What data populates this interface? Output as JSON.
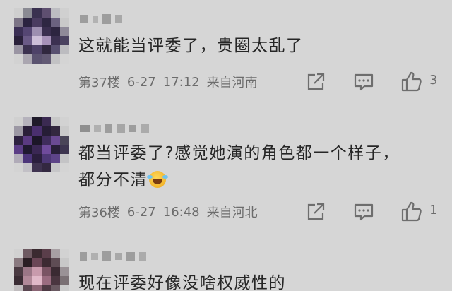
{
  "comments": [
    {
      "text_lines": [
        "这就能当评委了，贵圈太乱了"
      ],
      "floor": "第37楼",
      "date": "6-27",
      "time": "17:12",
      "location": "来自河南",
      "like_count": "3"
    },
    {
      "text_lines": [
        "都当评委了?感觉她演的角色都一个样子，",
        "都分不清"
      ],
      "emoji": "crying-laughing-emoji",
      "floor": "第36楼",
      "date": "6-27",
      "time": "16:48",
      "location": "来自河北",
      "like_count": "1"
    },
    {
      "text_lines": [
        "现在评委好像没啥权威性的"
      ]
    }
  ],
  "icons": {
    "share": "share-icon",
    "reply": "reply-icon",
    "like": "thumbs-up-icon"
  },
  "colors": {
    "background": "#d6d6d6",
    "text": "#262626",
    "meta": "#6c6c6c"
  }
}
